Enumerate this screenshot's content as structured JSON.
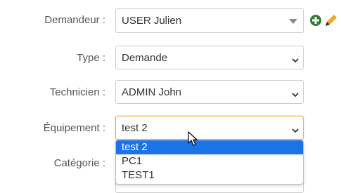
{
  "form": {
    "requester": {
      "label": "Demandeur :",
      "value": "USER Julien"
    },
    "type": {
      "label": "Type :",
      "value": "Demande"
    },
    "technician": {
      "label": "Technicien :",
      "value": "ADMIN John"
    },
    "equipment": {
      "label": "Équipement :",
      "value": "test 2",
      "options": [
        "test 2",
        "PC1",
        "TEST1"
      ]
    },
    "category": {
      "label": "Catégorie :"
    }
  },
  "icons": {
    "add": "plus-circle-icon",
    "edit": "pencil-icon"
  },
  "colors": {
    "accent": "#f0ad4e",
    "add_green": "#2e7d32",
    "pencil_yellow": "#f5a623",
    "selected_option": "#1a73e8"
  }
}
